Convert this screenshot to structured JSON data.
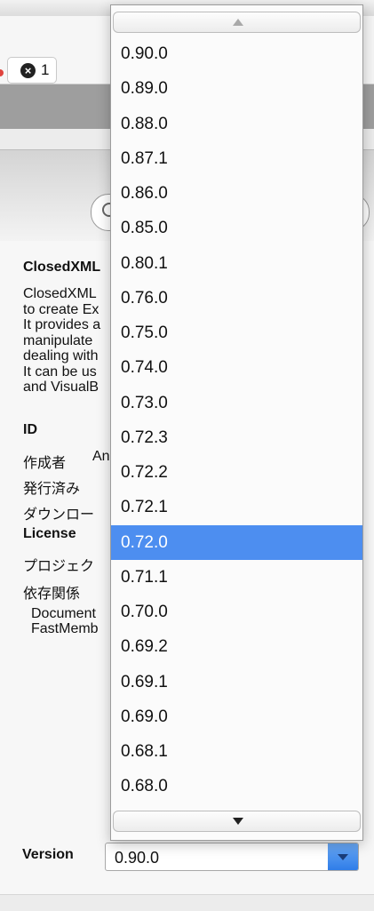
{
  "toolbar": {
    "error_count": "1"
  },
  "details": {
    "package_title": "ClosedXML",
    "description_lines": [
      "ClosedXML",
      "to create Ex",
      "It provides a",
      "manipulate",
      "dealing with",
      "It can be us",
      "and VisualB"
    ],
    "id_label": "ID",
    "author_label": "作成者",
    "author_value": "An",
    "published_label": "発行済み",
    "downloads_label": "ダウンロー",
    "license_label": "License",
    "project_label": "プロジェク",
    "dependencies_label": "依存関係",
    "dependencies": [
      "Document",
      "FastMemb"
    ]
  },
  "version": {
    "label": "Version",
    "selected": "0.90.0",
    "highlighted": "0.72.0",
    "options": [
      "0.90.0",
      "0.89.0",
      "0.88.0",
      "0.87.1",
      "0.86.0",
      "0.85.0",
      "0.80.1",
      "0.76.0",
      "0.75.0",
      "0.74.0",
      "0.73.0",
      "0.72.3",
      "0.72.2",
      "0.72.1",
      "0.72.0",
      "0.71.1",
      "0.70.0",
      "0.69.2",
      "0.69.1",
      "0.69.0",
      "0.68.1",
      "0.68.0"
    ]
  }
}
